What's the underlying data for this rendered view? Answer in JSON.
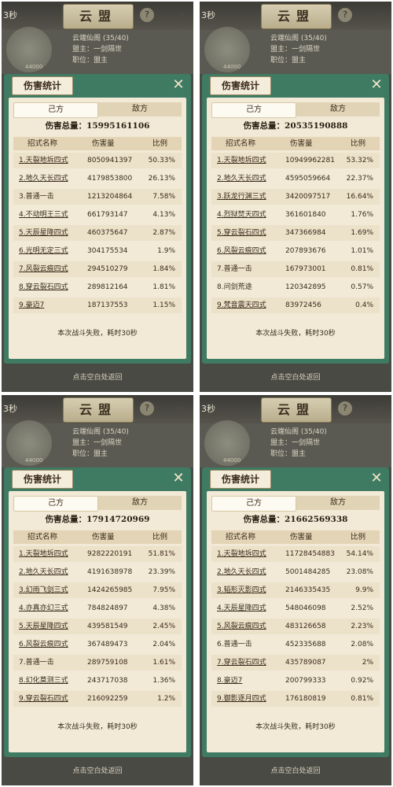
{
  "panels": [
    {
      "timer": "3秒",
      "top_info": "",
      "title": "云盟",
      "help": "?",
      "close_top": "✕",
      "guild": {
        "name": "云端仙阁 (35/40)",
        "leader": "盟主：一剑隔世",
        "role": "职位：盟主",
        "power": "44000"
      },
      "header": "伤害统计",
      "close": "✕",
      "tabs": [
        "己方",
        "敌方"
      ],
      "total": "伤害总量：15995161106",
      "columns": [
        "招式名称",
        "伤害量",
        "比例"
      ],
      "rows": [
        {
          "name": "1.天裂地坼四式",
          "dmg": "8050941397",
          "pct": "50.33%",
          "u": true
        },
        {
          "name": "2.地久天长四式",
          "dmg": "4179853800",
          "pct": "26.13%",
          "u": true
        },
        {
          "name": "3.普通一击",
          "dmg": "1213204864",
          "pct": "7.58%",
          "u": false
        },
        {
          "name": "4.不动明王三式",
          "dmg": "661793147",
          "pct": "4.13%",
          "u": true
        },
        {
          "name": "5.天辰星降四式",
          "dmg": "460375647",
          "pct": "2.87%",
          "u": true
        },
        {
          "name": "6.光明无定三式",
          "dmg": "304175534",
          "pct": "1.9%",
          "u": true
        },
        {
          "name": "7.风裂云痕四式",
          "dmg": "294510279",
          "pct": "1.84%",
          "u": true
        },
        {
          "name": "8.穿云裂石四式",
          "dmg": "289812164",
          "pct": "1.81%",
          "u": true
        },
        {
          "name": "9.豪迈7",
          "dmg": "187137553",
          "pct": "1.15%",
          "u": true
        }
      ],
      "summary": "本次战斗失败，耗时30秒",
      "bottom": "点击空白处返回"
    },
    {
      "timer": "3秒",
      "top_info": "",
      "title": "云盟",
      "help": "?",
      "close_top": "✕",
      "guild": {
        "name": "云端仙阁 (35/40)",
        "leader": "盟主：一剑隔世",
        "role": "职位：盟主",
        "power": "44000"
      },
      "header": "伤害统计",
      "close": "✕",
      "tabs": [
        "己方",
        "敌方"
      ],
      "total": "伤害总量：20535190888",
      "columns": [
        "招式名称",
        "伤害量",
        "比例"
      ],
      "rows": [
        {
          "name": "1.天裂地坼四式",
          "dmg": "10949962281",
          "pct": "53.32%",
          "u": true
        },
        {
          "name": "2.地久天长四式",
          "dmg": "4595059664",
          "pct": "22.37%",
          "u": true
        },
        {
          "name": "3.跃龙行渊三式",
          "dmg": "3420097517",
          "pct": "16.64%",
          "u": true
        },
        {
          "name": "4.烈狱焚天四式",
          "dmg": "361601840",
          "pct": "1.76%",
          "u": true
        },
        {
          "name": "5.穿云裂石四式",
          "dmg": "347366984",
          "pct": "1.69%",
          "u": true
        },
        {
          "name": "6.风裂云痕四式",
          "dmg": "207893676",
          "pct": "1.01%",
          "u": true
        },
        {
          "name": "7.普通一击",
          "dmg": "167973001",
          "pct": "0.81%",
          "u": false
        },
        {
          "name": "8.问剑荒途",
          "dmg": "120342895",
          "pct": "0.57%",
          "u": false
        },
        {
          "name": "9.梵音震天四式",
          "dmg": "83972456",
          "pct": "0.4%",
          "u": true
        }
      ],
      "summary": "本次战斗失败，耗时30秒",
      "bottom": "点击空白处返回"
    },
    {
      "timer": "3秒",
      "top_info": "",
      "title": "云盟",
      "help": "?",
      "close_top": "✕",
      "guild": {
        "name": "云端仙阁 (35/40)",
        "leader": "盟主：一剑隔世",
        "role": "职位：盟主",
        "power": "44000"
      },
      "header": "伤害统计",
      "close": "✕",
      "tabs": [
        "己方",
        "敌方"
      ],
      "total": "伤害总量：17914720969",
      "columns": [
        "招式名称",
        "伤害量",
        "比例"
      ],
      "rows": [
        {
          "name": "1.天裂地坼四式",
          "dmg": "9282220191",
          "pct": "51.81%",
          "u": true
        },
        {
          "name": "2.地久天长四式",
          "dmg": "4191638978",
          "pct": "23.39%",
          "u": true
        },
        {
          "name": "3.幻雨飞剑三式",
          "dmg": "1424265985",
          "pct": "7.95%",
          "u": true
        },
        {
          "name": "4.亦真亦幻三式",
          "dmg": "784824897",
          "pct": "4.38%",
          "u": true
        },
        {
          "name": "5.天辰星降四式",
          "dmg": "439581549",
          "pct": "2.45%",
          "u": true
        },
        {
          "name": "6.风裂云痕四式",
          "dmg": "367489473",
          "pct": "2.04%",
          "u": true
        },
        {
          "name": "7.普通一击",
          "dmg": "289759108",
          "pct": "1.61%",
          "u": false
        },
        {
          "name": "8.幻化莫测三式",
          "dmg": "243717038",
          "pct": "1.36%",
          "u": true
        },
        {
          "name": "9.穿云裂石四式",
          "dmg": "216092259",
          "pct": "1.2%",
          "u": true
        }
      ],
      "summary": "本次战斗失败，耗时30秒",
      "bottom": "点击空白处返回"
    },
    {
      "timer": "3秒",
      "top_info": "",
      "title": "云盟",
      "help": "?",
      "close_top": "✕",
      "guild": {
        "name": "云端仙阁 (35/40)",
        "leader": "盟主：一剑隔世",
        "role": "职位：盟主",
        "power": "44000"
      },
      "header": "伤害统计",
      "close": "✕",
      "tabs": [
        "己方",
        "敌方"
      ],
      "total": "伤害总量：21662569338",
      "columns": [
        "招式名称",
        "伤害量",
        "比例"
      ],
      "rows": [
        {
          "name": "1.天裂地坼四式",
          "dmg": "11728454883",
          "pct": "54.14%",
          "u": true
        },
        {
          "name": "2.地久天长四式",
          "dmg": "5001484285",
          "pct": "23.08%",
          "u": true
        },
        {
          "name": "3.韬形灭影四式",
          "dmg": "2146335435",
          "pct": "9.9%",
          "u": true
        },
        {
          "name": "4.天辰星降四式",
          "dmg": "548046098",
          "pct": "2.52%",
          "u": true
        },
        {
          "name": "5.风裂云痕四式",
          "dmg": "483126658",
          "pct": "2.23%",
          "u": true
        },
        {
          "name": "6.普通一击",
          "dmg": "452335688",
          "pct": "2.08%",
          "u": false
        },
        {
          "name": "7.穿云裂石四式",
          "dmg": "435789087",
          "pct": "2%",
          "u": true
        },
        {
          "name": "8.豪迈7",
          "dmg": "200799333",
          "pct": "0.92%",
          "u": true
        },
        {
          "name": "9.御影逐月四式",
          "dmg": "176180819",
          "pct": "0.81%",
          "u": true
        }
      ],
      "summary": "本次战斗失败，耗时30秒",
      "bottom": "点击空白处返回"
    }
  ]
}
